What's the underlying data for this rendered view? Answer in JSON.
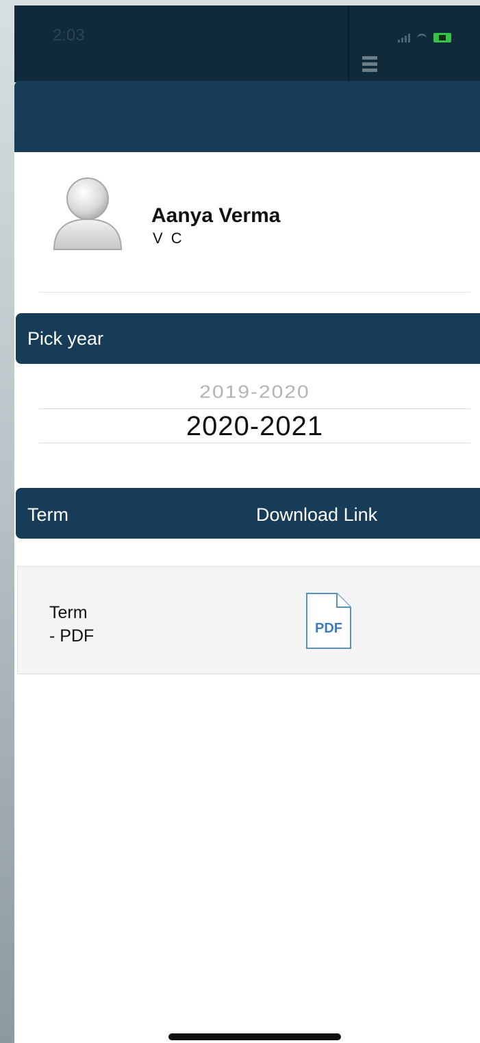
{
  "status_bar": {
    "time": "2:03",
    "battery_color": "#35c24a",
    "icons": [
      "signal-icon",
      "wifi-icon",
      "battery-icon"
    ]
  },
  "nav": {
    "back_icon": "chevron-left-icon",
    "bar_color": "#173c58"
  },
  "profile": {
    "name": "Aanya Verma",
    "role": "V C",
    "avatar_icon": "user-avatar-icon"
  },
  "year_picker": {
    "header": "Pick year",
    "previous_option": "2019-2020",
    "selected": "2020-2021"
  },
  "reports_table": {
    "headers": [
      "Term",
      "Download Link"
    ],
    "rows": [
      {
        "term_line1": "Term",
        "term_line2": "- PDF",
        "link_icon": "pdf-file-icon",
        "link_label": "PDF"
      }
    ]
  }
}
